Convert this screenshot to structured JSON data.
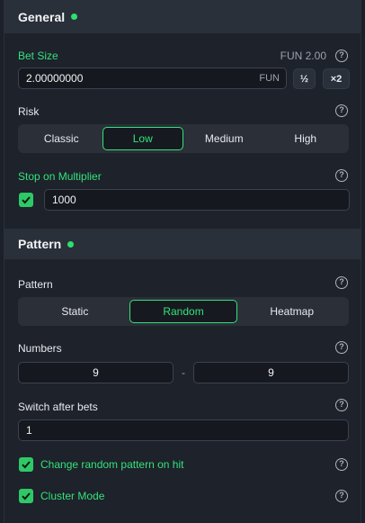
{
  "general": {
    "title": "General",
    "bet_size": {
      "label": "Bet Size",
      "display": "FUN 2.00",
      "value": "2.00000000",
      "currency": "FUN",
      "half_label": "½",
      "double_label": "×2"
    },
    "risk": {
      "label": "Risk",
      "options": [
        "Classic",
        "Low",
        "Medium",
        "High"
      ],
      "selected": "Low"
    },
    "stop_multiplier": {
      "label": "Stop on Multiplier",
      "checked": true,
      "value": "1000"
    }
  },
  "pattern": {
    "title": "Pattern",
    "pattern_field": {
      "label": "Pattern",
      "options": [
        "Static",
        "Random",
        "Heatmap"
      ],
      "selected": "Random"
    },
    "numbers": {
      "label": "Numbers",
      "min": "9",
      "separator": "-",
      "max": "9"
    },
    "switch_after_bets": {
      "label": "Switch after bets",
      "value": "1"
    },
    "change_random": {
      "label": "Change random pattern on hit",
      "checked": true
    },
    "cluster_mode": {
      "label": "Cluster Mode",
      "checked": true
    }
  },
  "help_glyph": "?",
  "colors": {
    "accent": "#34e27a",
    "status_dot": "#2ee06e",
    "panel": "#1d222b",
    "header": "#2a303a"
  }
}
